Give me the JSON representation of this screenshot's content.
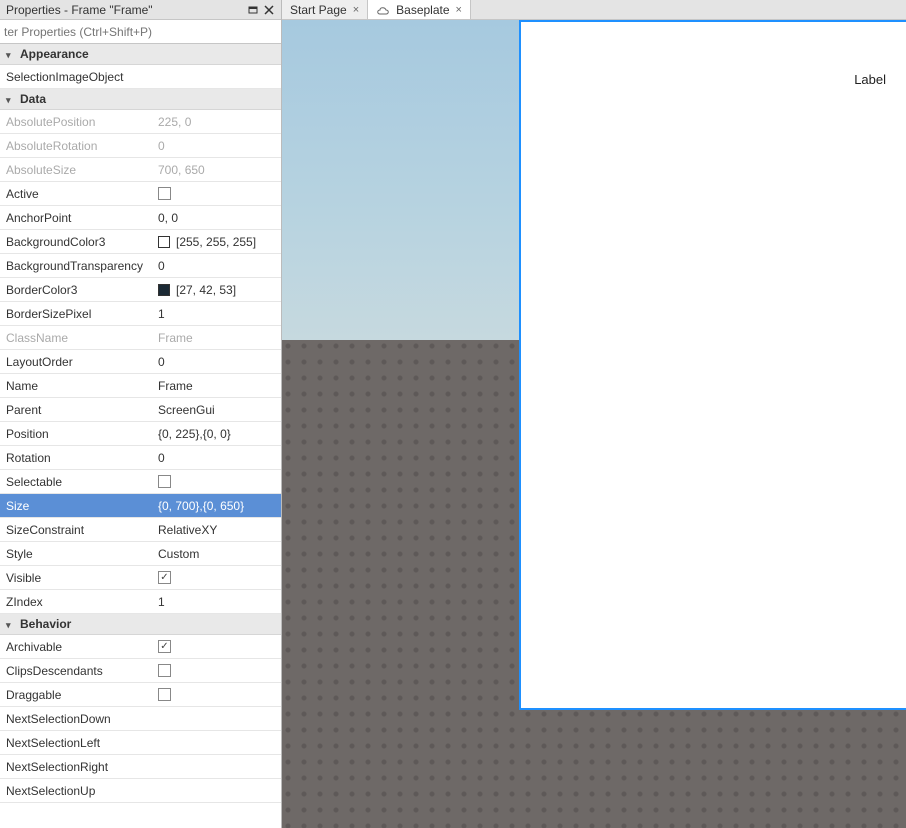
{
  "panel": {
    "title": "Properties - Frame \"Frame\"",
    "filter_placeholder": "ter Properties (Ctrl+Shift+P)"
  },
  "tabs": [
    {
      "label": "Start Page"
    },
    {
      "label": "Baseplate"
    }
  ],
  "viewport": {
    "label_text": "Label"
  },
  "groups": [
    {
      "name": "Appearance",
      "rows": [
        {
          "k": "SelectionImageObject",
          "v": ""
        }
      ]
    },
    {
      "name": "Data",
      "rows": [
        {
          "k": "AbsolutePosition",
          "v": "225, 0",
          "ro": true
        },
        {
          "k": "AbsoluteRotation",
          "v": "0",
          "ro": true
        },
        {
          "k": "AbsoluteSize",
          "v": "700, 650",
          "ro": true
        },
        {
          "k": "Active",
          "v": "",
          "cb": true,
          "checked": false
        },
        {
          "k": "AnchorPoint",
          "v": "0, 0"
        },
        {
          "k": "BackgroundColor3",
          "v": "[255, 255, 255]",
          "swatch": "#ffffff"
        },
        {
          "k": "BackgroundTransparency",
          "v": "0"
        },
        {
          "k": "BorderColor3",
          "v": "[27, 42, 53]",
          "swatch": "#1b2a35"
        },
        {
          "k": "BorderSizePixel",
          "v": "1"
        },
        {
          "k": "ClassName",
          "v": "Frame",
          "ro": true
        },
        {
          "k": "LayoutOrder",
          "v": "0"
        },
        {
          "k": "Name",
          "v": "Frame"
        },
        {
          "k": "Parent",
          "v": "ScreenGui"
        },
        {
          "k": "Position",
          "v": "{0, 225},{0, 0}"
        },
        {
          "k": "Rotation",
          "v": "0"
        },
        {
          "k": "Selectable",
          "v": "",
          "cb": true,
          "checked": false
        },
        {
          "k": "Size",
          "v": "{0, 700},{0, 650}",
          "sel": true
        },
        {
          "k": "SizeConstraint",
          "v": "RelativeXY"
        },
        {
          "k": "Style",
          "v": "Custom"
        },
        {
          "k": "Visible",
          "v": "",
          "cb": true,
          "checked": true
        },
        {
          "k": "ZIndex",
          "v": "1"
        }
      ]
    },
    {
      "name": "Behavior",
      "rows": [
        {
          "k": "Archivable",
          "v": "",
          "cb": true,
          "checked": true
        },
        {
          "k": "ClipsDescendants",
          "v": "",
          "cb": true,
          "checked": false
        },
        {
          "k": "Draggable",
          "v": "",
          "cb": true,
          "checked": false
        },
        {
          "k": "NextSelectionDown",
          "v": ""
        },
        {
          "k": "NextSelectionLeft",
          "v": ""
        },
        {
          "k": "NextSelectionRight",
          "v": ""
        },
        {
          "k": "NextSelectionUp",
          "v": ""
        }
      ]
    }
  ]
}
